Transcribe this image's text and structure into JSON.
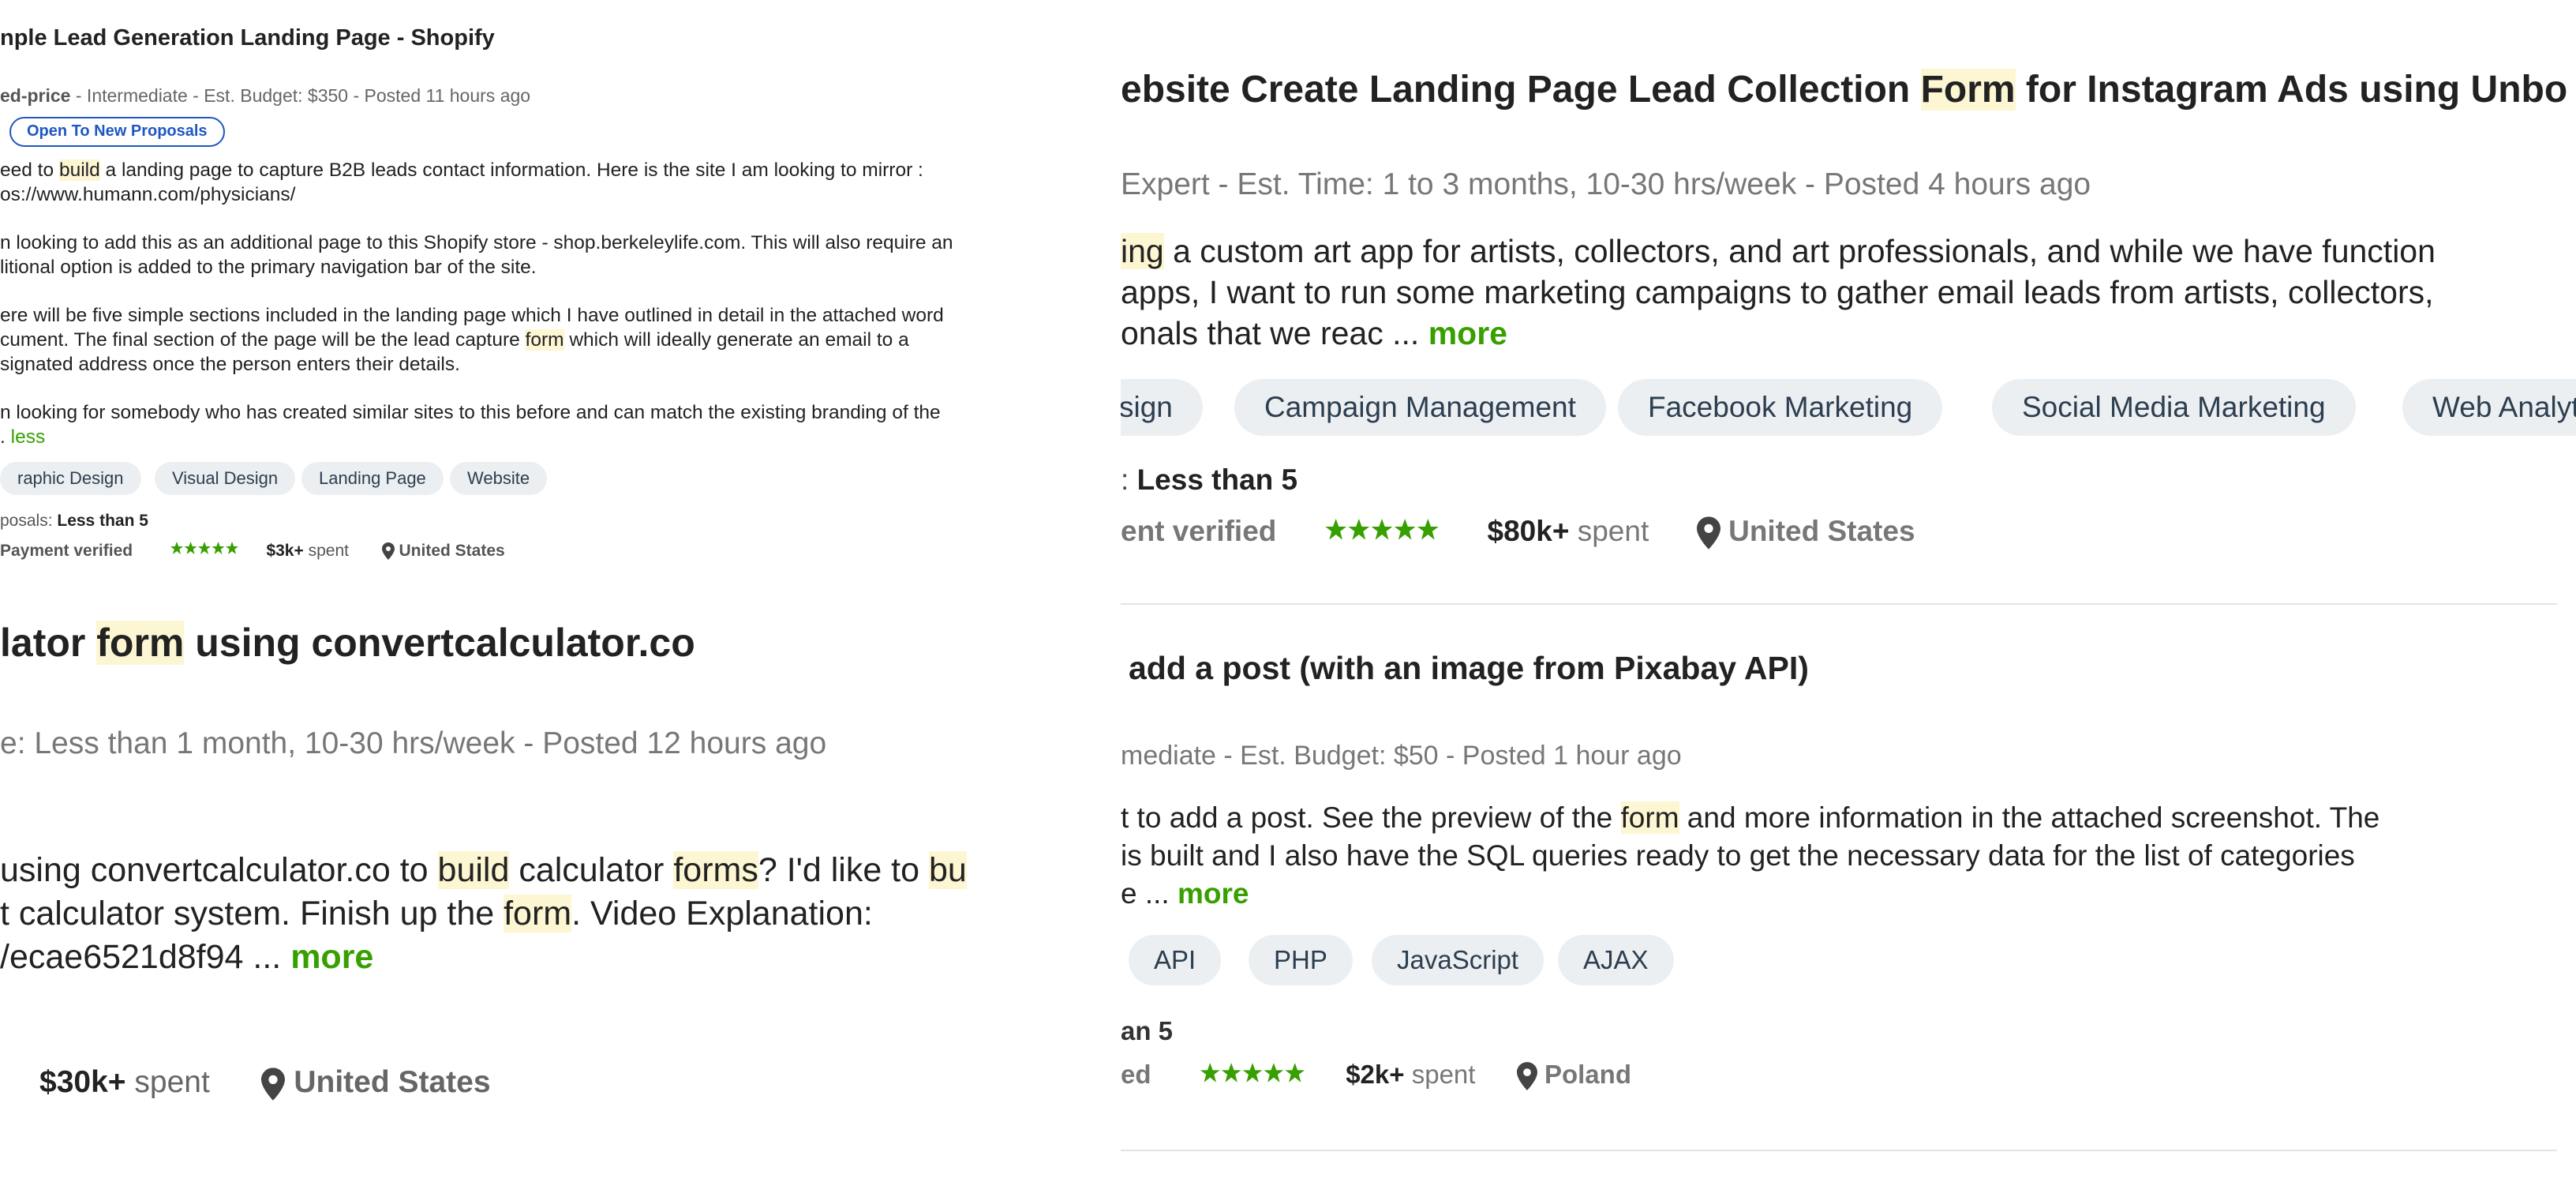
{
  "job1": {
    "title": "nple Lead Generation Landing Page - Shopify",
    "meta_lead": "ed-price",
    "meta_rest": " - Intermediate - Est. Budget: $350 - Posted 11 hours ago",
    "badge": "Open To New Proposals",
    "para1_l1_a": "eed to ",
    "para1_l1_hl": "build",
    "para1_l1_b": " a landing page to capture B2B leads contact information. Here is the site I am looking to mirror :",
    "para1_l2": "os://www.humann.com/physicians/",
    "para2_l1": "n looking to add this as an additional page to this Shopify store - shop.berkeleylife.com. This will also require an",
    "para2_l2": "litional option is added to the primary navigation bar of the site.",
    "para3_l1": "ere will be five simple sections included in the landing page which I have outlined in detail in the attached word",
    "para3_l2_a": "cument. The final section of the page will be the lead capture ",
    "para3_l2_hl": "form",
    "para3_l2_b": " which will ideally generate an email to a",
    "para3_l3": "signated address once the person enters their details.",
    "para4_l1": "n looking for somebody who has created similar sites to this before and can match the existing branding of the",
    "para4_l2": ". ",
    "less": "less",
    "tags": [
      "raphic Design",
      "Visual Design",
      "Landing Page",
      "Website"
    ],
    "proposals_label": "posals: ",
    "proposals_value": "Less than 5",
    "payment": "Payment verified",
    "spent_amount": "$3k+",
    "spent_word": " spent",
    "location": "United States",
    "rating_stars": 5
  },
  "job2": {
    "title_a": "lator ",
    "title_hl": "form",
    "title_b": " using convertcalculator.co",
    "meta": "e: Less than 1 month, 10-30 hrs/week - Posted 12 hours ago",
    "l1_a": " using convertcalculator.co to ",
    "l1_hl1": "build",
    "l1_b": " calculator ",
    "l1_hl2": "forms",
    "l1_c": "? I'd like to ",
    "l1_hl3": "bu",
    "l2_a": "t calculator system. Finish up the ",
    "l2_hl": "form",
    "l2_b": ". Video Explanation:",
    "l3": "/ecae6521d8f94 ... ",
    "more": "more",
    "spent_amount": "$30k+",
    "spent_word": " spent",
    "location": "United States"
  },
  "job3": {
    "title_a": "ebsite Create Landing Page Lead Collection ",
    "title_hl": "Form",
    "title_b": " for Instagram Ads using Unbo",
    "meta": "Expert - Est. Time: 1 to 3 months, 10-30 hrs/week - Posted 4 hours ago",
    "l1_hl": "ing",
    "l1_rest": " a custom art app for artists, collectors, and art professionals, and while we have function",
    "l2": "apps, I want to run some marketing campaigns to gather email leads from artists, collectors,",
    "l3": "onals that we reac ... ",
    "more": "more",
    "tags": [
      "sign",
      "Campaign Management",
      "Facebook Marketing",
      "Social Media Marketing",
      "Web Analyt"
    ],
    "proposals_label": ": ",
    "proposals_value": "Less than 5",
    "payment": "ent verified",
    "spent_amount": "$80k+",
    "spent_word": " spent",
    "location": "United States",
    "rating_stars": 5
  },
  "job4": {
    "title": " add a post (with an image from Pixabay API)",
    "meta": "mediate - Est. Budget: $50 - Posted 1 hour ago",
    "l1_a": "t to add a post. See the preview of the ",
    "l1_hl": "form",
    "l1_b": " and more information in the attached screenshot. The",
    "l2": "is built and I also have the SQL queries ready to get the necessary data for the list of categories",
    "l3": "e ... ",
    "more": "more",
    "tags": [
      "API",
      "PHP",
      "JavaScript",
      "AJAX"
    ],
    "proposals": "an 5",
    "payment": "ed",
    "spent_amount": "$2k+",
    "spent_word": " spent",
    "location": "Poland",
    "rating_stars": 5
  },
  "colors": {
    "accent_green": "#37a000",
    "highlight": "#fdf6d3",
    "badge_blue": "#1f57c3",
    "tag_bg": "#eceff1",
    "star_green": "#37a000"
  },
  "icons": {
    "location": "map-pin-icon",
    "rating": "star-icon"
  }
}
